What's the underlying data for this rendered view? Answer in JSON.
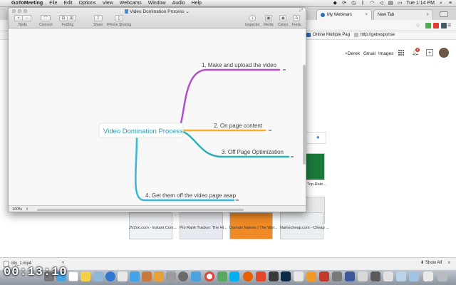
{
  "menubar": {
    "app": "GoToMeeting",
    "menus": [
      "File",
      "Edit",
      "Options",
      "View",
      "Webcams",
      "Window",
      "Audio",
      "Help"
    ],
    "clock": "Tue 1:14 PM"
  },
  "chrome": {
    "tabs": [
      {
        "label": "My Webinars",
        "close": "×"
      },
      {
        "label": "New Tab",
        "close": "×"
      }
    ],
    "bookmarks": [
      {
        "label": "Online Multiple Pag",
        "color": "#2d6db5"
      },
      {
        "label": "http://getresponse",
        "color": "#777777"
      }
    ],
    "google_links": {
      "user": "+Derek",
      "gmail": "Gmail",
      "images": "Images",
      "notifications": "4"
    },
    "tiles": [
      {
        "caption": "JVZoo.com - Instant Com..."
      },
      {
        "caption": "Pro Rank Tracker: The Hi..."
      },
      {
        "caption": "Domain Names | The Wor..."
      },
      {
        "caption": "Namecheap.com - Cheap ..."
      },
      {
        "caption": "Top-Rate..."
      }
    ],
    "download": {
      "file": "city_1.mp4",
      "show_all": "Show All",
      "close": "×"
    }
  },
  "mindmap": {
    "title": "Video Domination Process",
    "title_caret": "⌄",
    "toolbar_left": [
      {
        "label": "Node",
        "glyphs": [
          "+",
          "−"
        ]
      },
      {
        "label": "Connect",
        "glyphs": [
          "⌒"
        ]
      },
      {
        "label": "Folding",
        "glyphs": [
          "⊟",
          "⊞"
        ]
      }
    ],
    "toolbar_mid": [
      {
        "label": "Share",
        "glyph": "⇪"
      },
      {
        "label": "iPhone Sharing",
        "glyph": "▯"
      }
    ],
    "toolbar_right": [
      {
        "label": "Inspector",
        "glyph": "i"
      },
      {
        "label": "Media",
        "glyph": "▣"
      },
      {
        "label": "Colors",
        "glyph": "◉"
      },
      {
        "label": "Fonts",
        "glyph": "A"
      }
    ],
    "zoom": "100%",
    "root": "Video Domination Process",
    "branches": [
      {
        "label": "1. Make and upload the video",
        "color": "#b14fd1"
      },
      {
        "label": "2. On page content",
        "color": "#f2b130"
      },
      {
        "label": "3. Off Page Optimization",
        "color": "#2fb0b8"
      },
      {
        "label": "4. Get them off the video page asap",
        "color": "#39b7d8"
      }
    ]
  },
  "overlay": {
    "timer": "00:13:10"
  }
}
